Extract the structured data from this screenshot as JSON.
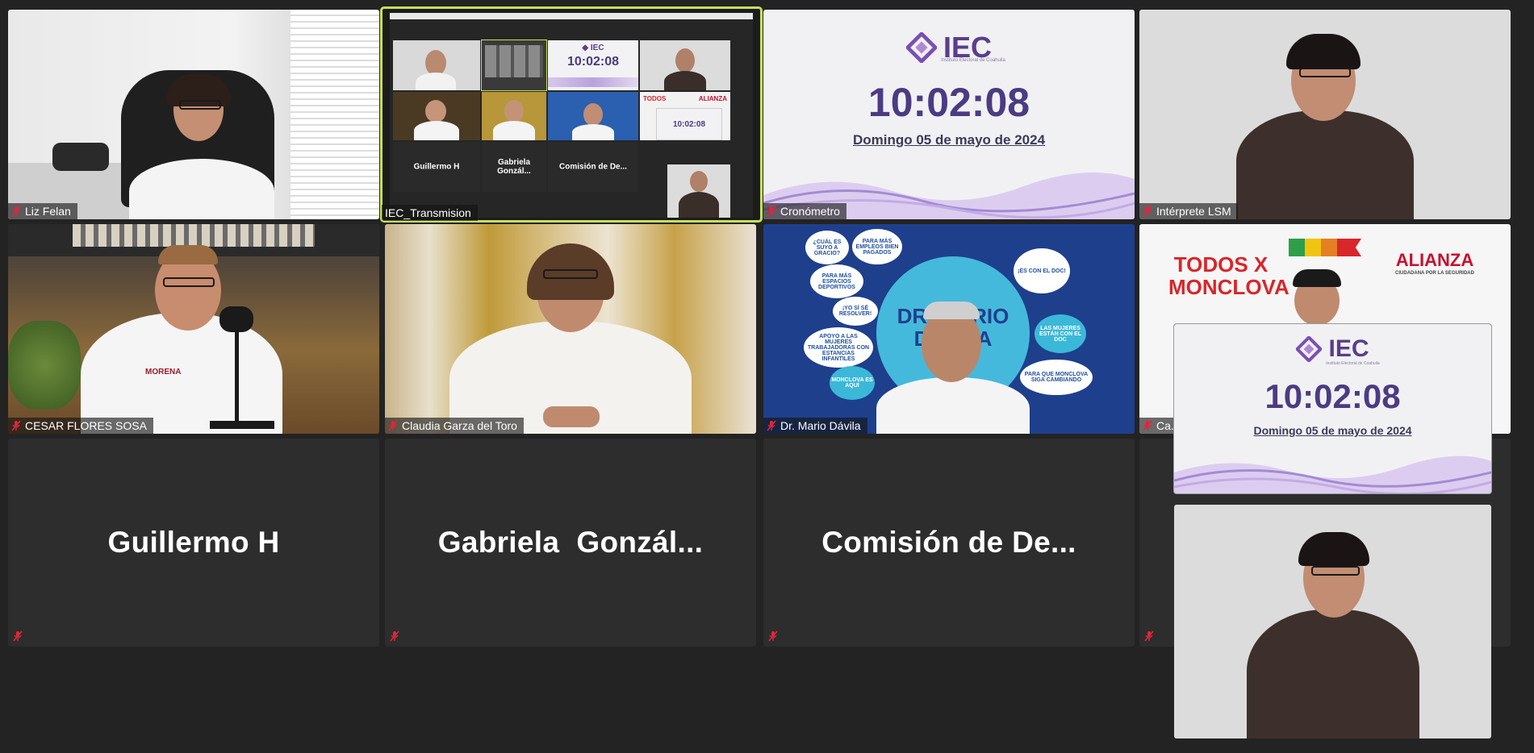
{
  "tiles": {
    "liz": {
      "name": "Liz Felan"
    },
    "screen_share": {
      "name": "IEC_Transmision",
      "mini_names": [
        "Guillermo H",
        "Gabriela  Gonzál...",
        "Comisión de De..."
      ],
      "mini_clock": "10:02:08"
    },
    "cronometro": {
      "name": "Cronómetro",
      "logo_text": "IEC",
      "logo_sub": "Instituto Electoral de Coahuila",
      "clock": "10:02:08",
      "date": "Domingo 05 de mayo de 2024"
    },
    "interprete": {
      "name": "Intérprete LSM"
    },
    "cesar": {
      "name": "CESAR FLORES SOSA",
      "shirt_text": "MORENA"
    },
    "claudia": {
      "name": "Claudia Garza del Toro"
    },
    "mario": {
      "name": "Dr. Mario Dávila",
      "poster_title": "DR. MARIO DÁVILA",
      "bubbles": [
        "¿CUÁL ES SUYO A GRACIO?",
        "PARA MÁS EMPLEOS BIEN PAGADOS",
        "¡ES CON EL DOC!",
        "PARA MÁS ESPACIOS DEPORTIVOS",
        "¡YO SÍ SÉ RESOLVER!",
        "APOYO A LAS MUJERES TRABAJADORAS CON ESTANCIAS INFANTILES",
        "MONCLOVA ES AQUÍ",
        "LAS MUJERES ESTÁN CON EL DOC",
        "PARA QUE MONCLOVA SIGA CAMBIANDO"
      ]
    },
    "alianza": {
      "name": "Ca...",
      "todos": "TODOS X MONCLOVA",
      "alianza": "ALIANZA",
      "alianza_sub": "CIUDADANA POR LA SEGURIDAD"
    },
    "guillermo": {
      "name": "Guillermo H"
    },
    "gabriela": {
      "name": "Gabriela  Gonzál..."
    },
    "comision": {
      "name": "Comisión de De..."
    }
  },
  "pip": {
    "logo_text": "IEC",
    "logo_sub": "Instituto Electoral de Coahuila",
    "clock": "10:02:08",
    "date": "Domingo 05 de mayo de 2024"
  },
  "colors": {
    "active_border": "#c6e05b",
    "mic_muted": "#e0263a",
    "iec_purple": "#4b3b83"
  }
}
